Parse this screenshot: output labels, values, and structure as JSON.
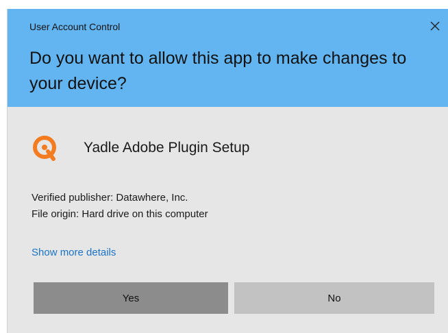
{
  "dialog": {
    "window_title": "User Account Control",
    "question": "Do you want to allow this app to make changes to your device?",
    "app_name": "Yadle Adobe Plugin Setup",
    "app_icon": "yadle-logo-icon",
    "verified_publisher": "Verified publisher: Datawhere, Inc.",
    "file_origin": "File origin: Hard drive on this computer",
    "details_link": "Show more details",
    "yes_label": "Yes",
    "no_label": "No",
    "close_icon": "close-icon"
  },
  "colors": {
    "header_bg": "#62b5f1",
    "body_bg": "#e6e6e6",
    "link": "#1a73c9",
    "yes_button_bg": "#8c8c8c",
    "no_button_bg": "#c2c2c2",
    "logo_orange": "#f47c20"
  }
}
